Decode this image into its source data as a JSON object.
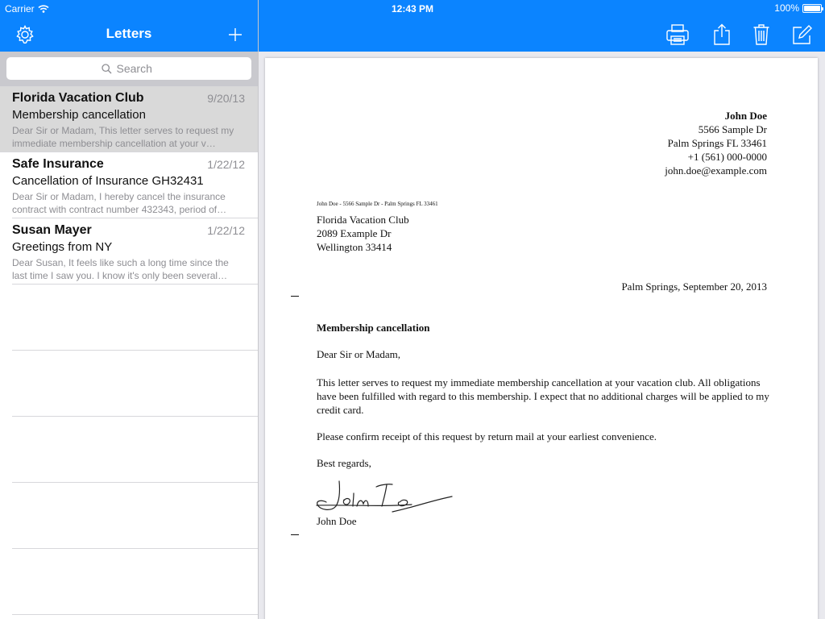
{
  "status_bar": {
    "carrier": "Carrier",
    "time": "12:43 PM",
    "battery": "100%"
  },
  "master_nav": {
    "title": "Letters",
    "settings_icon": "gear-icon",
    "add_icon": "plus-icon"
  },
  "detail_toolbar": {
    "icons": [
      "printer-icon",
      "share-icon",
      "trash-icon",
      "compose-icon"
    ]
  },
  "search": {
    "placeholder": "Search"
  },
  "letters": [
    {
      "from": "Florida Vacation Club",
      "date": "9/20/13",
      "subject": "Membership cancellation",
      "preview": "Dear Sir or Madam,  This letter serves to request my immediate membership cancellation at your v…",
      "selected": true
    },
    {
      "from": "Safe Insurance",
      "date": "1/22/12",
      "subject": "Cancellation of Insurance GH32431",
      "preview": "Dear Sir or Madam,  I hereby cancel the insurance contract with contract number 432343, period of…",
      "selected": false
    },
    {
      "from": "Susan Mayer",
      "date": "1/22/12",
      "subject": "Greetings from NY",
      "preview": "Dear Susan,  It feels like such a long time since the last time I saw you. I know it's only been several…",
      "selected": false
    }
  ],
  "letter": {
    "sender": {
      "name": "John Doe",
      "street": "5566 Sample Dr",
      "city": "Palm Springs FL 33461",
      "phone": "+1 (561) 000-0000",
      "email": "john.doe@example.com"
    },
    "return_address": "John Doe - 5566 Sample Dr - Palm Springs FL 33461",
    "recipient": {
      "name": "Florida Vacation Club",
      "street": "2089 Example Dr",
      "city": "Wellington  33414"
    },
    "place_date": "Palm Springs, September 20, 2013",
    "subject": "Membership cancellation",
    "salutation": "Dear Sir or Madam,",
    "body": [
      "This letter serves to request my immediate membership cancellation at your vacation club. All obligations have been fulfilled with regard to this membership. I expect that no additional charges will be applied to my credit card.",
      "Please confirm receipt of this request by return mail at your earliest convenience."
    ],
    "closing": "Best regards,",
    "signature_name": "John Doe"
  },
  "colors": {
    "bar_blue": "#0b84ff",
    "selected_row": "#d9d9d9",
    "secondary_text": "#8e8e93"
  }
}
